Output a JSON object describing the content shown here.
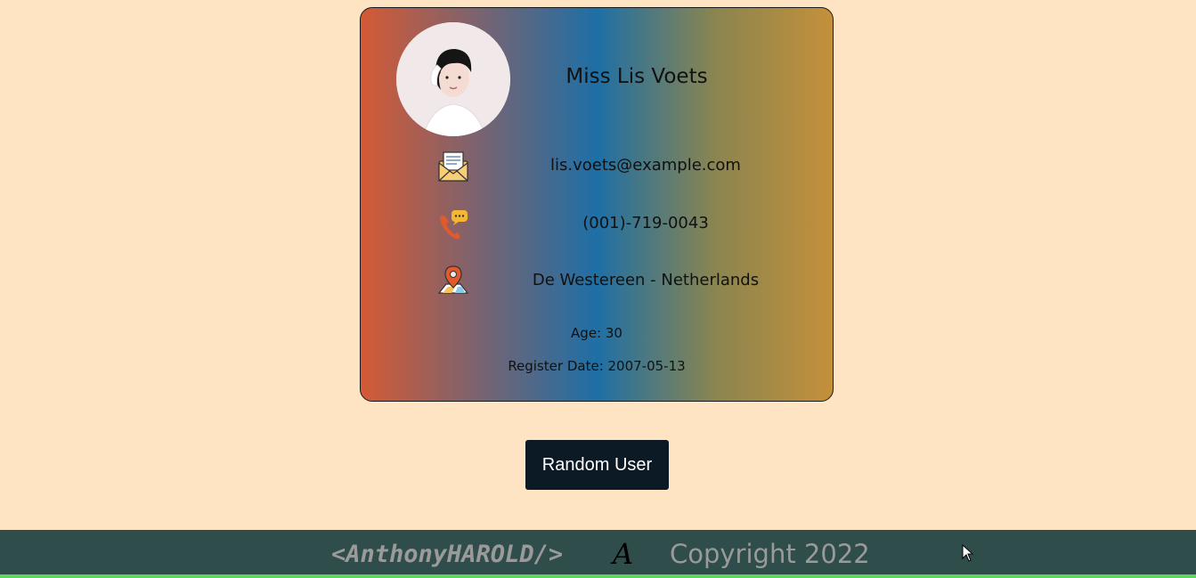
{
  "user": {
    "name": "Miss Lis Voets",
    "email": "lis.voets@example.com",
    "phone": "(001)-719-0043",
    "location": "De Westereen - Netherlands",
    "age_label": "Age: 30",
    "register_label": "Register Date: 2007-05-13"
  },
  "icons": {
    "email": "envelope-icon",
    "phone": "phone-chat-icon",
    "location": "map-pin-icon"
  },
  "button": {
    "label": "Random User"
  },
  "footer": {
    "brand": "<AnthonyHAROLD/>",
    "logo": "A",
    "copyright": "Copyright 2022"
  },
  "colors": {
    "background": "#ffe4c4",
    "button": "#0b1a24",
    "footer": "#2f4d4a",
    "footer_accent": "#5cd65c"
  }
}
